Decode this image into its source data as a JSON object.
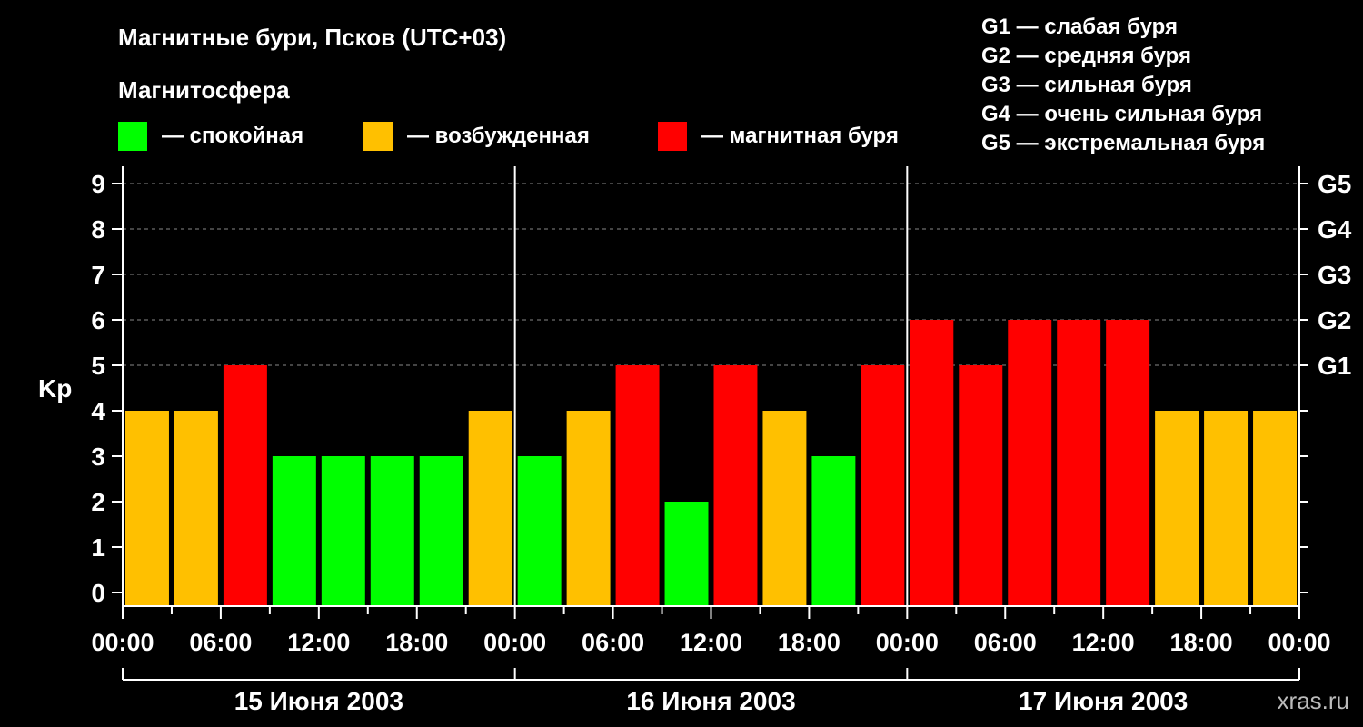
{
  "title": "Магнитные бури, Псков (UTC+03)",
  "legend": {
    "heading": "Магнитосфера",
    "items": [
      {
        "label": "— спокойная",
        "color": "#00ff00"
      },
      {
        "label": "— возбужденная",
        "color": "#ffc000"
      },
      {
        "label": "— магнитная буря",
        "color": "#ff0000"
      }
    ],
    "g_scale": [
      "G1 — слабая буря",
      "G2 — средняя буря",
      "G3 — сильная буря",
      "G4 — очень сильная буря",
      "G5 — экстремальная буря"
    ]
  },
  "watermark": "xras.ru",
  "chart_data": {
    "type": "bar",
    "ylabel": "Kp",
    "ylim": [
      0,
      9
    ],
    "yticks": [
      "0",
      "1",
      "2",
      "3",
      "4",
      "5",
      "6",
      "7",
      "8",
      "9"
    ],
    "right_ticks": [
      {
        "value": 5,
        "label": "G1"
      },
      {
        "value": 6,
        "label": "G2"
      },
      {
        "value": 7,
        "label": "G3"
      },
      {
        "value": 8,
        "label": "G4"
      },
      {
        "value": 9,
        "label": "G5"
      }
    ],
    "xticks": [
      "00:00",
      "06:00",
      "12:00",
      "18:00",
      "00:00",
      "06:00",
      "12:00",
      "18:00",
      "00:00",
      "06:00",
      "12:00",
      "18:00",
      "00:00"
    ],
    "days": [
      "15 Июня 2003",
      "16 Июня 2003",
      "17 Июня 2003"
    ],
    "values": [
      4,
      4,
      5,
      3,
      3,
      3,
      3,
      4,
      3,
      4,
      5,
      2,
      5,
      4,
      3,
      5,
      6,
      5,
      6,
      6,
      6,
      4,
      4,
      4
    ],
    "colors": {
      "quiet": "#00ff00",
      "active": "#ffc000",
      "storm": "#ff0000"
    },
    "grid": "dashed horizontal at 5–9",
    "legend_position": "top"
  }
}
